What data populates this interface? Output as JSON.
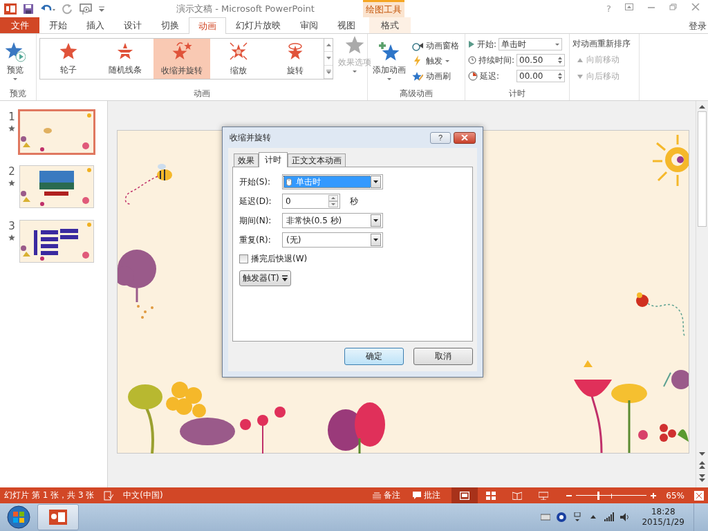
{
  "title_bar": {
    "title": "演示文稿 - Microsoft PowerPoint",
    "contextual_label": "绘图工具",
    "help": "?"
  },
  "tabs": [
    {
      "label": "文件",
      "kind": "file",
      "selected": false
    },
    {
      "label": "开始",
      "kind": "normal",
      "selected": false
    },
    {
      "label": "插入",
      "kind": "normal",
      "selected": false
    },
    {
      "label": "设计",
      "kind": "normal",
      "selected": false
    },
    {
      "label": "切换",
      "kind": "normal",
      "selected": false
    },
    {
      "label": "动画",
      "kind": "normal",
      "selected": true
    },
    {
      "label": "幻灯片放映",
      "kind": "normal",
      "selected": false
    },
    {
      "label": "审阅",
      "kind": "normal",
      "selected": false
    },
    {
      "label": "视图",
      "kind": "normal",
      "selected": false
    },
    {
      "label": "格式",
      "kind": "contextual",
      "selected": false
    }
  ],
  "account": "登录",
  "ribbon": {
    "preview": {
      "label": "预览",
      "group": "预览"
    },
    "gallery": {
      "group": "动画",
      "items": [
        {
          "label": "轮子",
          "selected": false
        },
        {
          "label": "随机线条",
          "selected": false
        },
        {
          "label": "收缩并旋转",
          "selected": true
        },
        {
          "label": "缩放",
          "selected": false
        },
        {
          "label": "旋转",
          "selected": false
        }
      ]
    },
    "effect_options": {
      "label": "效果选项",
      "disabled": true
    },
    "advanced": {
      "group": "高级动画",
      "add": "添加动画",
      "pane": "动画窗格",
      "trigger": "触发",
      "painter": "动画刷"
    },
    "timing": {
      "group": "计时",
      "start_label": "开始:",
      "start_value": "单击时",
      "duration_label": "持续时间:",
      "duration_value": "00.50",
      "delay_label": "延迟:",
      "delay_value": "00.00"
    },
    "reorder": {
      "title": "对动画重新排序",
      "items": [
        {
          "label": "向前移动",
          "disabled": true
        },
        {
          "label": "向后移动",
          "disabled": true
        }
      ]
    }
  },
  "slides": [
    {
      "number": "1",
      "selected": true
    },
    {
      "number": "2",
      "selected": false
    },
    {
      "number": "3",
      "selected": false
    }
  ],
  "dialog": {
    "title": "收缩并旋转",
    "help": "?",
    "tabs": [
      {
        "label": "效果",
        "selected": false
      },
      {
        "label": "计时",
        "selected": true
      },
      {
        "label": "正文文本动画",
        "selected": false
      }
    ],
    "start": {
      "label": "开始(S):",
      "value": "单击时"
    },
    "delay": {
      "label": "延迟(D):",
      "value": "0",
      "unit": "秒"
    },
    "duration": {
      "label": "期间(N):",
      "value": "非常快(0.5 秒)"
    },
    "repeat": {
      "label": "重复(R):",
      "value": "(无)"
    },
    "rewind": {
      "label": "播完后快退(W)",
      "checked": false
    },
    "trigger": "触发器(T)",
    "ok": "确定",
    "cancel": "取消"
  },
  "status_bar": {
    "slide_info": "幻灯片 第 1 张，共 3 张",
    "language": "中文(中国)",
    "notes": "备注",
    "comments": "批注",
    "zoom": "65%",
    "zoom_slider": {
      "level": 0.31
    }
  },
  "taskbar": {
    "time": "18:28",
    "date": "2015/1/29"
  }
}
